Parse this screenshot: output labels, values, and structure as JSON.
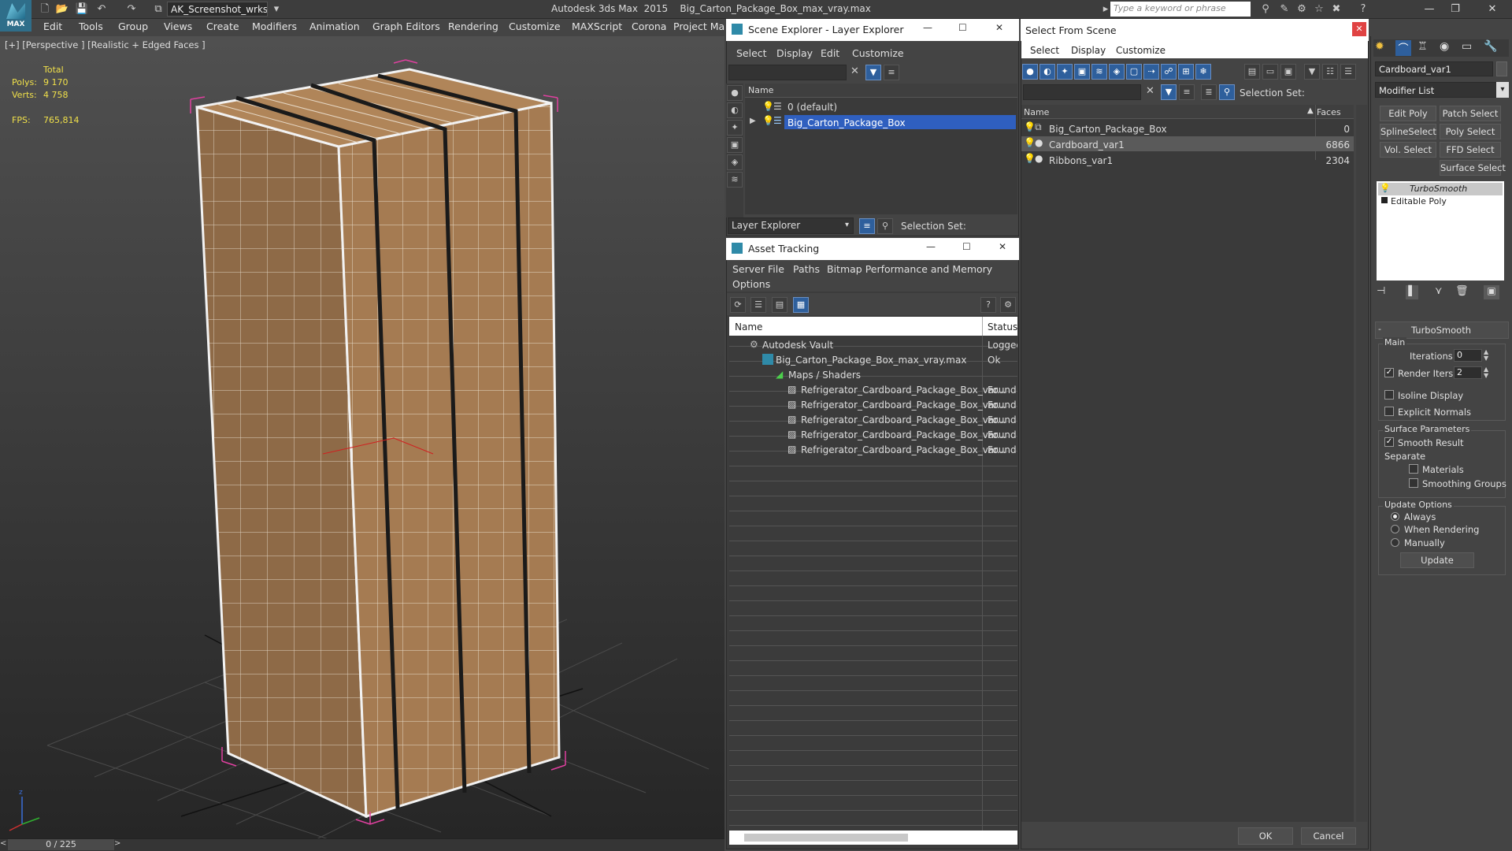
{
  "title_bar": {
    "logo_text": "MAX",
    "workspace": "AK_Screenshot_wrksp",
    "app_title": "Autodesk 3ds Max  2015    Big_Carton_Package_Box_max_vray.max",
    "search_placeholder": "Type a keyword or phrase"
  },
  "menu": [
    "Edit",
    "Tools",
    "Group",
    "Views",
    "Create",
    "Modifiers",
    "Animation",
    "Graph Editors",
    "Rendering",
    "Customize",
    "MAXScript",
    "Corona",
    "Project Man"
  ],
  "viewport": {
    "label": "[+] [Perspective ] [Realistic + Edged Faces ]",
    "stats_header": "Total",
    "polys_label": "Polys:",
    "polys_value": "9 170",
    "verts_label": "Verts:",
    "verts_value": "4 758",
    "fps_label": "FPS:",
    "fps_value": "765,814"
  },
  "timeline": {
    "frame": "0 / 225"
  },
  "scene_explorer": {
    "title": "Scene Explorer - Layer Explorer",
    "menus": [
      "Select",
      "Display",
      "Edit",
      "Customize"
    ],
    "column_name": "Name",
    "layers": [
      "0 (default)",
      "Big_Carton_Package_Box"
    ],
    "footer_dropdown": "Layer Explorer",
    "selection_set_label": "Selection Set:"
  },
  "asset_tracking": {
    "title": "Asset Tracking",
    "menus": [
      "Server",
      "File",
      "Paths",
      "Bitmap Performance and Memory"
    ],
    "menu_row2": "Options",
    "col_name": "Name",
    "col_status": "Status",
    "rows": [
      {
        "name": "Autodesk Vault",
        "status": "Logged"
      },
      {
        "name": "Big_Carton_Package_Box_max_vray.max",
        "status": "Ok"
      },
      {
        "name": "Maps / Shaders",
        "status": ""
      },
      {
        "name": "Refrigerator_Cardboard_Package_Box_var...",
        "status": "Found"
      },
      {
        "name": "Refrigerator_Cardboard_Package_Box_var...",
        "status": "Found"
      },
      {
        "name": "Refrigerator_Cardboard_Package_Box_var...",
        "status": "Found"
      },
      {
        "name": "Refrigerator_Cardboard_Package_Box_var...",
        "status": "Found"
      },
      {
        "name": "Refrigerator_Cardboard_Package_Box_var...",
        "status": "Found"
      }
    ]
  },
  "select_from_scene": {
    "title": "Select From Scene",
    "menus": [
      "Select",
      "Display",
      "Customize"
    ],
    "selection_set_label": "Selection Set:",
    "col_name": "Name",
    "col_faces": "Faces",
    "rows": [
      {
        "name": "Big_Carton_Package_Box",
        "faces": "0"
      },
      {
        "name": "Cardboard_var1",
        "faces": "6866"
      },
      {
        "name": "Ribbons_var1",
        "faces": "2304"
      }
    ],
    "ok": "OK",
    "cancel": "Cancel"
  },
  "command_panel": {
    "object_name": "Cardboard_var1",
    "modifier_list": "Modifier List",
    "mod_buttons": [
      "Edit Poly",
      "Patch Select",
      "SplineSelect",
      "Poly Select",
      "Vol. Select",
      "FFD Select",
      "Surface Select"
    ],
    "stack": [
      "TurboSmooth",
      "Editable Poly"
    ],
    "rollout_title": "TurboSmooth",
    "main_label": "Main",
    "iterations_label": "Iterations:",
    "iterations_value": "0",
    "render_iters_label": "Render Iters:",
    "render_iters_value": "2",
    "isoline": "Isoline Display",
    "explicit": "Explicit Normals",
    "surface_params": "Surface Parameters",
    "smooth_result": "Smooth Result",
    "separate": "Separate",
    "materials": "Materials",
    "smoothing_groups": "Smoothing Groups",
    "update_options": "Update Options",
    "always": "Always",
    "when_rendering": "When Rendering",
    "manually": "Manually",
    "update_btn": "Update"
  }
}
